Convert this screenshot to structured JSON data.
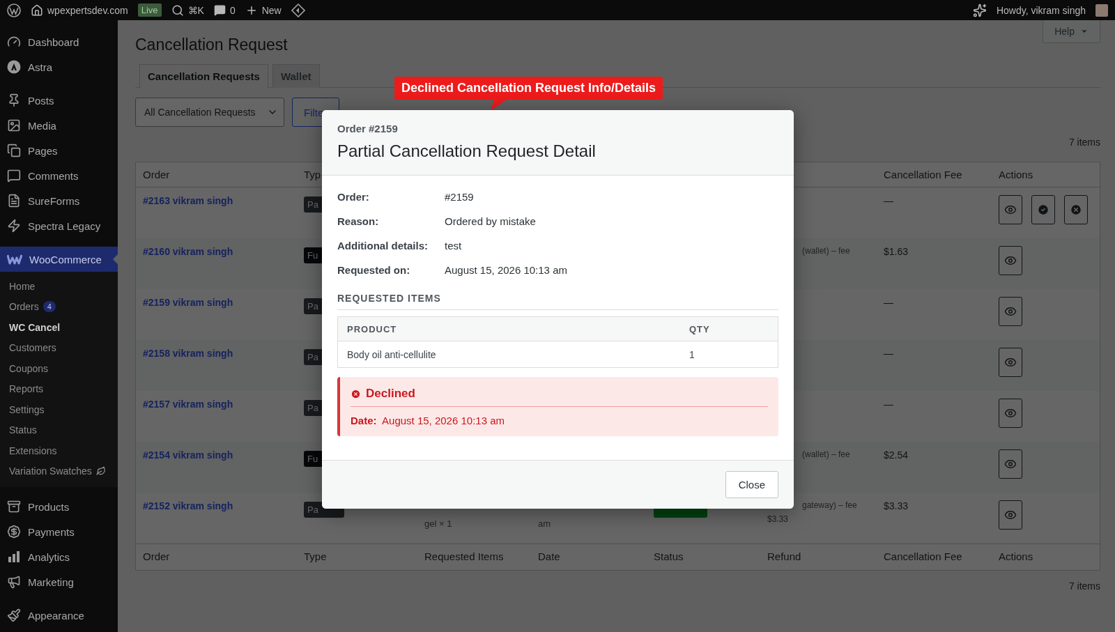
{
  "admin_bar": {
    "site": "wpexpertsdev.com",
    "env_badge": "Live",
    "search_shortcut": "⌘K",
    "comments": "0",
    "new": "New",
    "greeting": "Howdy, vikram singh"
  },
  "sidebar": {
    "groups": [
      {
        "items": [
          {
            "label": "Dashboard",
            "kind": "gauge",
            "selected": false
          },
          {
            "label": "Astra",
            "kind": "astra",
            "selected": false
          }
        ]
      },
      {
        "items": [
          {
            "label": "Posts",
            "kind": "pin",
            "selected": false
          },
          {
            "label": "Media",
            "kind": "media",
            "selected": false
          },
          {
            "label": "Pages",
            "kind": "pages",
            "selected": false
          },
          {
            "label": "Comments",
            "kind": "comment",
            "selected": false
          },
          {
            "label": "SureForms",
            "kind": "form",
            "selected": false
          },
          {
            "label": "Spectra Legacy",
            "kind": "bolt",
            "selected": false
          }
        ]
      },
      {
        "items": [
          {
            "label": "WooCommerce",
            "kind": "woo",
            "selected": true,
            "children": [
              {
                "label": "Home",
                "selected": false
              },
              {
                "label": "Orders",
                "count": "4",
                "selected": false
              },
              {
                "label": "WC Cancel",
                "selected": true
              },
              {
                "label": "Customers",
                "selected": false
              },
              {
                "label": "Coupons",
                "selected": false
              },
              {
                "label": "Reports",
                "selected": false
              },
              {
                "label": "Settings",
                "selected": false
              },
              {
                "label": "Status",
                "selected": false
              },
              {
                "label": "Extensions",
                "selected": false
              },
              {
                "label": "Variation Swatches",
                "kind": "leaf",
                "selected": false
              }
            ]
          },
          {
            "label": "Products",
            "kind": "archive",
            "selected": false
          },
          {
            "label": "Payments",
            "kind": "dollar",
            "selected": false
          },
          {
            "label": "Analytics",
            "kind": "bars",
            "selected": false
          },
          {
            "label": "Marketing",
            "kind": "megaphone",
            "selected": false
          }
        ]
      },
      {
        "items": [
          {
            "label": "Appearance",
            "kind": "brush",
            "selected": false
          }
        ]
      }
    ]
  },
  "page": {
    "title": "Cancellation Request",
    "help": "Help",
    "tabs": [
      {
        "label": "Cancellation Requests",
        "selected": true
      },
      {
        "label": "Wallet",
        "selected": false
      }
    ],
    "filter_select": "All Cancellation Requests",
    "filter_button": "Filte",
    "count_top": "7 items",
    "count_bottom": "7 items"
  },
  "table": {
    "header": {
      "order": "Order",
      "type": "Typ",
      "fee": "Cancellation Fee",
      "actions": "Actions"
    },
    "footer": {
      "order": "Order",
      "type": "Type",
      "items": "Requested Items",
      "date": "Date",
      "status": "Status",
      "refund": "Refund",
      "fee": "Cancellation Fee",
      "actions": "Actions"
    },
    "rows": [
      {
        "order": "#2163 vikram singh",
        "type": {
          "label": "Pa",
          "kind": "partial"
        },
        "fee": "—",
        "actions": [
          {
            "kind": "view"
          },
          {
            "kind": "approve"
          },
          {
            "kind": "decline"
          }
        ]
      },
      {
        "order": "#2160 vikram singh",
        "type": {
          "label": "Fu",
          "kind": "full"
        },
        "refund": [
          "(wallet) – fee"
        ],
        "fee": "$1.63",
        "actions": [
          {
            "kind": "view"
          }
        ]
      },
      {
        "order": "#2159 vikram singh",
        "type": {
          "label": "Pa",
          "kind": "partial"
        },
        "fee": "—",
        "actions": [
          {
            "kind": "view"
          }
        ]
      },
      {
        "order": "#2158 vikram singh",
        "type": {
          "label": "Pa",
          "kind": "partial"
        },
        "fee": "—",
        "actions": [
          {
            "kind": "view"
          }
        ]
      },
      {
        "order": "#2157 vikram singh",
        "type": {
          "label": "Pa",
          "kind": "partial"
        },
        "fee": "—",
        "actions": [
          {
            "kind": "view"
          }
        ]
      },
      {
        "order": "#2154 vikram singh",
        "type": {
          "label": "Fu",
          "kind": "full"
        },
        "refund": [
          "(wallet) – fee"
        ],
        "fee": "$2.54",
        "actions": [
          {
            "kind": "view"
          }
        ]
      },
      {
        "order": "#2152 vikram singh",
        "type": {
          "label": "Pa",
          "kind": "partial"
        },
        "items": "gel × 1",
        "date": "am",
        "status": {
          "kind": "approved"
        },
        "refund": [
          "gateway) – fee",
          "$3.33"
        ],
        "fee": "$3.33",
        "actions": [
          {
            "kind": "view"
          }
        ]
      }
    ]
  },
  "callout": {
    "text": "Declined Cancellation Request Info/Details"
  },
  "modal": {
    "subtitle": "Order #2159",
    "title": "Partial Cancellation Request Detail",
    "details": [
      {
        "label": "Order:",
        "value": "#2159"
      },
      {
        "label": "Reason:",
        "value": "Ordered by mistake"
      },
      {
        "label": "Additional details:",
        "value": "test"
      },
      {
        "label": "Requested on:",
        "value": "August 15, 2026 10:13 am"
      }
    ],
    "section": "REQUESTED ITEMS",
    "items_table": {
      "columns": [
        "PRODUCT",
        "QTY"
      ],
      "rows": [
        [
          "Body oil anti-cellulite",
          "1"
        ]
      ]
    },
    "status": {
      "kind": "declined",
      "title": "Declined",
      "date_label": "Date:",
      "date": "August 15, 2026 10:13 am"
    },
    "close": "Close"
  }
}
